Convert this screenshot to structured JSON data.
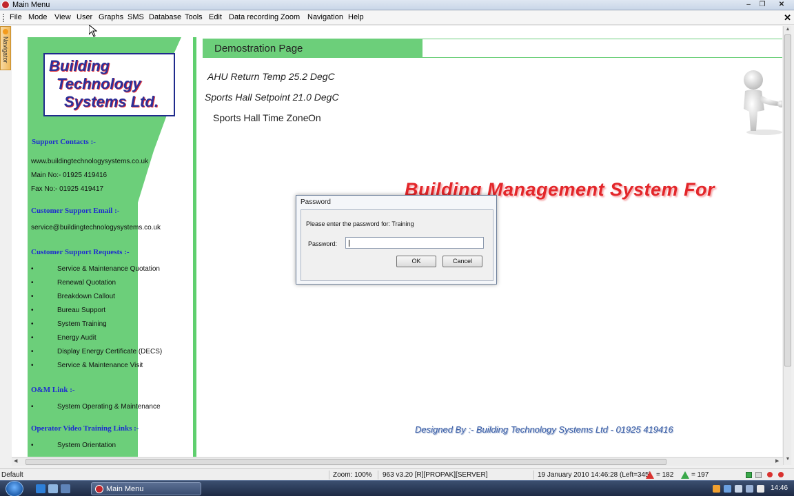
{
  "window": {
    "title": "Main Menu"
  },
  "menu": [
    "File",
    "Mode",
    "View",
    "User",
    "Graphs",
    "SMS",
    "Database",
    "Tools",
    "Edit",
    "Data recording",
    "Zoom",
    "Navigation",
    "Help"
  ],
  "navigator_tab": "Navigator",
  "logo": {
    "lines": [
      "Building",
      "Technology",
      "Systems Ltd."
    ]
  },
  "sidebar": {
    "support_contacts_heading": "Support Contacts :-",
    "website": "www.buildingtechnologysystems.co.uk",
    "main_no": "Main No:-  01925 419416",
    "fax_no": "Fax No:-   01925 419417",
    "email_heading": "Customer Support Email :-",
    "email": "service@buildingtechnologysystems.co.uk",
    "requests_heading": "Customer Support Requests :-",
    "requests": [
      "Service & Maintenance Quotation",
      "Renewal Quotation",
      "Breakdown Callout",
      "Bureau Support",
      "System Training",
      "Energy Audit",
      "Display Energy Certificate (DECS)",
      "Service & Maintenance Visit"
    ],
    "om_heading": "O&M Link :-",
    "om_items": [
      "System Operating & Maintenance"
    ],
    "video_heading": "Operator Video Training Links :-",
    "video_items": [
      "System Orientation"
    ]
  },
  "page": {
    "title": "Demostration Page",
    "ahu_return_temp": "AHU Return Temp 25.2 DegC",
    "sports_hall_setpoint": "Sports Hall Setpoint 21.0 DegC",
    "time_zone_label": "Sports Hall Time Zone",
    "time_zone_value": "On",
    "bms_title": "Building Management System For",
    "designed_by": "Designed By :- Building Technology Systems Ltd - 01925 419416"
  },
  "dialog": {
    "title": "Password",
    "prompt": "Please enter the password for: Training",
    "password_label": "Password:",
    "password_value": "",
    "ok": "OK",
    "cancel": "Cancel"
  },
  "status": {
    "mode": "Default",
    "zoom": "Zoom: 100%",
    "version": "963 v3.20 [R][PROPAK][SERVER]",
    "datetime": "19 January 2010 14:46:28 (Left=345)",
    "count_a": "= 182",
    "count_b": "= 197"
  },
  "taskbar": {
    "task_label": "Main Menu",
    "clock": "14:46"
  },
  "colors": {
    "sidebar_green": "#6ccf7a",
    "heading_blue": "#1e2dcf",
    "bms_red": "#e3262a"
  }
}
